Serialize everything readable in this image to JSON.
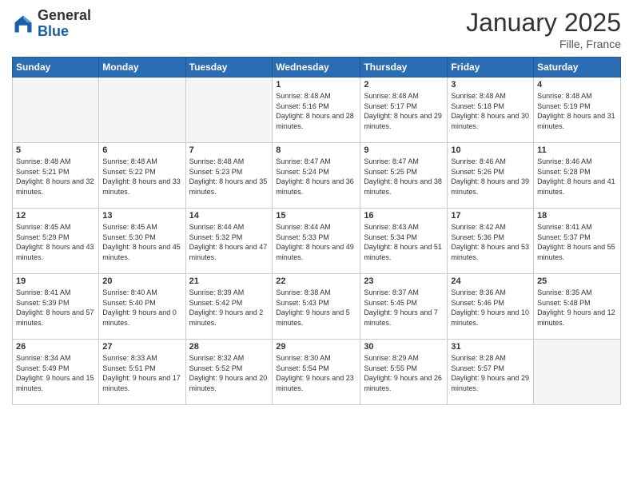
{
  "header": {
    "logo_general": "General",
    "logo_blue": "Blue",
    "month": "January 2025",
    "location": "Fille, France"
  },
  "days_header": [
    "Sunday",
    "Monday",
    "Tuesday",
    "Wednesday",
    "Thursday",
    "Friday",
    "Saturday"
  ],
  "weeks": [
    [
      {
        "num": "",
        "info": ""
      },
      {
        "num": "",
        "info": ""
      },
      {
        "num": "",
        "info": ""
      },
      {
        "num": "1",
        "info": "Sunrise: 8:48 AM\nSunset: 5:16 PM\nDaylight: 8 hours and 28 minutes."
      },
      {
        "num": "2",
        "info": "Sunrise: 8:48 AM\nSunset: 5:17 PM\nDaylight: 8 hours and 29 minutes."
      },
      {
        "num": "3",
        "info": "Sunrise: 8:48 AM\nSunset: 5:18 PM\nDaylight: 8 hours and 30 minutes."
      },
      {
        "num": "4",
        "info": "Sunrise: 8:48 AM\nSunset: 5:19 PM\nDaylight: 8 hours and 31 minutes."
      }
    ],
    [
      {
        "num": "5",
        "info": "Sunrise: 8:48 AM\nSunset: 5:21 PM\nDaylight: 8 hours and 32 minutes."
      },
      {
        "num": "6",
        "info": "Sunrise: 8:48 AM\nSunset: 5:22 PM\nDaylight: 8 hours and 33 minutes."
      },
      {
        "num": "7",
        "info": "Sunrise: 8:48 AM\nSunset: 5:23 PM\nDaylight: 8 hours and 35 minutes."
      },
      {
        "num": "8",
        "info": "Sunrise: 8:47 AM\nSunset: 5:24 PM\nDaylight: 8 hours and 36 minutes."
      },
      {
        "num": "9",
        "info": "Sunrise: 8:47 AM\nSunset: 5:25 PM\nDaylight: 8 hours and 38 minutes."
      },
      {
        "num": "10",
        "info": "Sunrise: 8:46 AM\nSunset: 5:26 PM\nDaylight: 8 hours and 39 minutes."
      },
      {
        "num": "11",
        "info": "Sunrise: 8:46 AM\nSunset: 5:28 PM\nDaylight: 8 hours and 41 minutes."
      }
    ],
    [
      {
        "num": "12",
        "info": "Sunrise: 8:45 AM\nSunset: 5:29 PM\nDaylight: 8 hours and 43 minutes."
      },
      {
        "num": "13",
        "info": "Sunrise: 8:45 AM\nSunset: 5:30 PM\nDaylight: 8 hours and 45 minutes."
      },
      {
        "num": "14",
        "info": "Sunrise: 8:44 AM\nSunset: 5:32 PM\nDaylight: 8 hours and 47 minutes."
      },
      {
        "num": "15",
        "info": "Sunrise: 8:44 AM\nSunset: 5:33 PM\nDaylight: 8 hours and 49 minutes."
      },
      {
        "num": "16",
        "info": "Sunrise: 8:43 AM\nSunset: 5:34 PM\nDaylight: 8 hours and 51 minutes."
      },
      {
        "num": "17",
        "info": "Sunrise: 8:42 AM\nSunset: 5:36 PM\nDaylight: 8 hours and 53 minutes."
      },
      {
        "num": "18",
        "info": "Sunrise: 8:41 AM\nSunset: 5:37 PM\nDaylight: 8 hours and 55 minutes."
      }
    ],
    [
      {
        "num": "19",
        "info": "Sunrise: 8:41 AM\nSunset: 5:39 PM\nDaylight: 8 hours and 57 minutes."
      },
      {
        "num": "20",
        "info": "Sunrise: 8:40 AM\nSunset: 5:40 PM\nDaylight: 9 hours and 0 minutes."
      },
      {
        "num": "21",
        "info": "Sunrise: 8:39 AM\nSunset: 5:42 PM\nDaylight: 9 hours and 2 minutes."
      },
      {
        "num": "22",
        "info": "Sunrise: 8:38 AM\nSunset: 5:43 PM\nDaylight: 9 hours and 5 minutes."
      },
      {
        "num": "23",
        "info": "Sunrise: 8:37 AM\nSunset: 5:45 PM\nDaylight: 9 hours and 7 minutes."
      },
      {
        "num": "24",
        "info": "Sunrise: 8:36 AM\nSunset: 5:46 PM\nDaylight: 9 hours and 10 minutes."
      },
      {
        "num": "25",
        "info": "Sunrise: 8:35 AM\nSunset: 5:48 PM\nDaylight: 9 hours and 12 minutes."
      }
    ],
    [
      {
        "num": "26",
        "info": "Sunrise: 8:34 AM\nSunset: 5:49 PM\nDaylight: 9 hours and 15 minutes."
      },
      {
        "num": "27",
        "info": "Sunrise: 8:33 AM\nSunset: 5:51 PM\nDaylight: 9 hours and 17 minutes."
      },
      {
        "num": "28",
        "info": "Sunrise: 8:32 AM\nSunset: 5:52 PM\nDaylight: 9 hours and 20 minutes."
      },
      {
        "num": "29",
        "info": "Sunrise: 8:30 AM\nSunset: 5:54 PM\nDaylight: 9 hours and 23 minutes."
      },
      {
        "num": "30",
        "info": "Sunrise: 8:29 AM\nSunset: 5:55 PM\nDaylight: 9 hours and 26 minutes."
      },
      {
        "num": "31",
        "info": "Sunrise: 8:28 AM\nSunset: 5:57 PM\nDaylight: 9 hours and 29 minutes."
      },
      {
        "num": "",
        "info": ""
      }
    ]
  ]
}
